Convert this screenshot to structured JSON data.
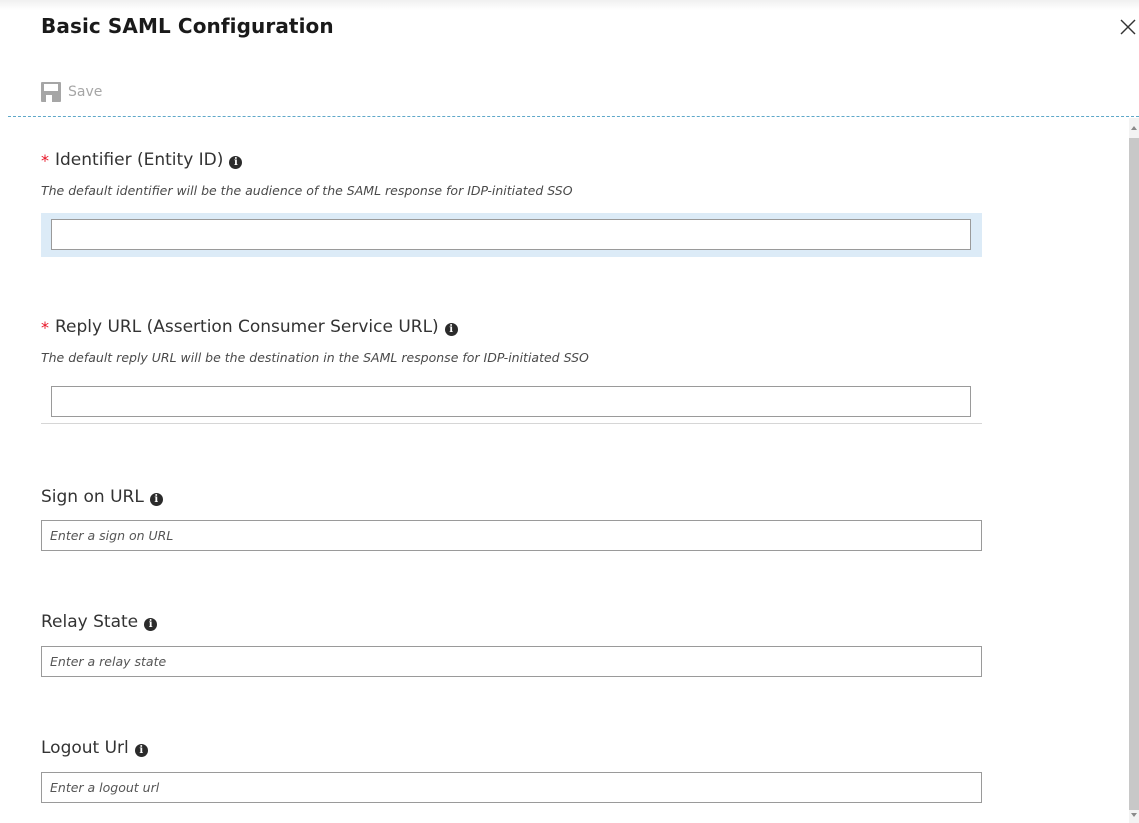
{
  "title": "Basic SAML Configuration",
  "toolbar": {
    "save_label": "Save",
    "close_icon": "close-icon",
    "save_icon": "floppy-disk-icon"
  },
  "fields": {
    "identifier": {
      "required_mark": "*",
      "label": "Identifier (Entity ID)",
      "description": "The default identifier will be the audience of the SAML response for IDP-initiated SSO",
      "value": "",
      "placeholder": ""
    },
    "reply_url": {
      "required_mark": "*",
      "label": "Reply URL (Assertion Consumer Service URL)",
      "description": "The default reply URL will be the destination in the SAML response for IDP-initiated SSO",
      "value": "",
      "placeholder": ""
    },
    "sign_on_url": {
      "label": "Sign on URL",
      "value": "",
      "placeholder": "Enter a sign on URL"
    },
    "relay_state": {
      "label": "Relay State",
      "value": "",
      "placeholder": "Enter a relay state"
    },
    "logout_url": {
      "label": "Logout Url",
      "value": "",
      "placeholder": "Enter a logout url"
    }
  },
  "info_icon_glyph": "i",
  "colors": {
    "required": "#e81123",
    "divider": "#5fa8c9",
    "focus_highlight": "#dcebf7",
    "save_disabled": "#a6a6a6"
  }
}
